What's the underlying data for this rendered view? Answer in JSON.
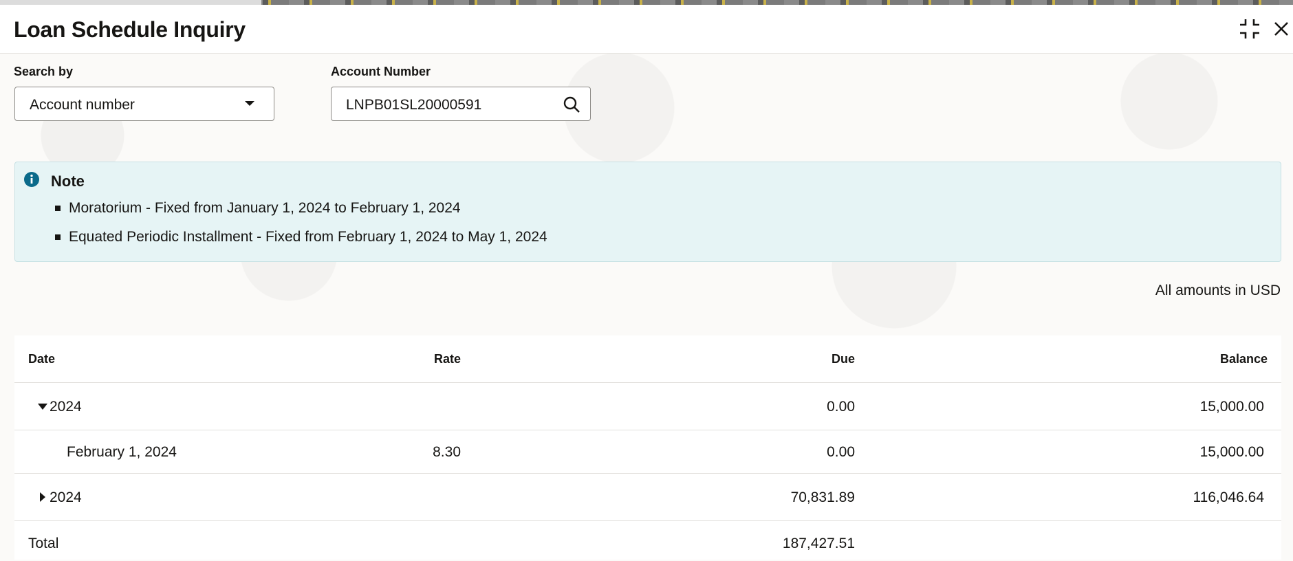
{
  "window": {
    "title": "Loan Schedule Inquiry",
    "icons": {
      "collapse": "collapse-icon",
      "close": "close-icon"
    }
  },
  "search": {
    "search_by_label": "Search by",
    "search_by_value": "Account number",
    "account_label": "Account Number",
    "account_value": "LNPB01SL20000591",
    "search_icon": "search-icon"
  },
  "note": {
    "title": "Note",
    "items": [
      "Moratorium - Fixed from January 1, 2024 to February 1, 2024",
      "Equated Periodic Installment - Fixed from February 1, 2024 to May 1, 2024"
    ]
  },
  "amounts_note": "All amounts in USD",
  "table": {
    "columns": [
      "Date",
      "Rate",
      "Due",
      "Balance"
    ],
    "rows": [
      {
        "date": "2024",
        "rate": "",
        "due": "0.00",
        "balance": "15,000.00",
        "expanded": true
      },
      {
        "date": "February 1, 2024",
        "rate": "8.30",
        "due": "0.00",
        "balance": "15,000.00"
      },
      {
        "date": "2024",
        "rate": "",
        "due": "70,831.89",
        "balance": "116,046.64",
        "expanded": false
      }
    ],
    "total": {
      "label": "Total",
      "due": "187,427.51"
    }
  },
  "colors": {
    "note_background": "#e6f4f5",
    "info_icon": "#0b6a8a",
    "text": "#161513"
  }
}
